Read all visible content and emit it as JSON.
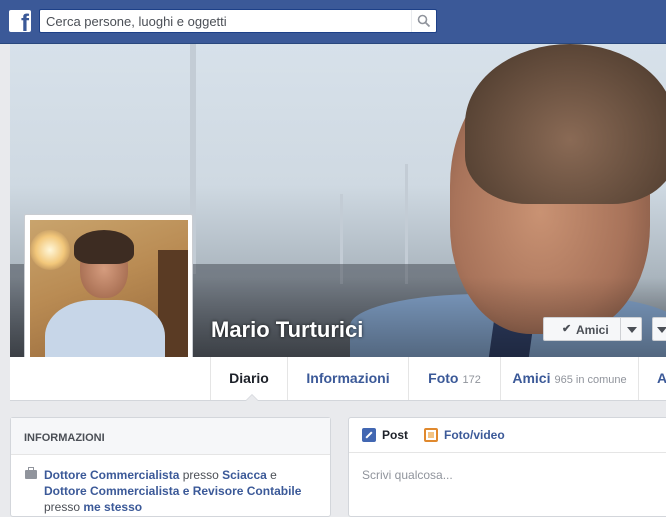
{
  "header": {
    "logo": "f",
    "search_placeholder": "Cerca persone, luoghi e oggetti",
    "brand_color": "#3b5998"
  },
  "profile": {
    "name": "Mario Turturici",
    "friends_button": "Amici"
  },
  "tabs": [
    {
      "label": "Diario",
      "count": ""
    },
    {
      "label": "Informazioni",
      "count": ""
    },
    {
      "label": "Foto",
      "count": "172"
    },
    {
      "label": "Amici",
      "count": "965 in comune"
    },
    {
      "label": "A",
      "count": ""
    }
  ],
  "info": {
    "title": "INFORMAZIONI",
    "line_link1": "Dottore Commercialista",
    "presso1": "presso",
    "link2": "Sciacca",
    "e": "e",
    "line_link3": "Dottore Commercialista e Revisore Contabile",
    "presso2": "presso",
    "link4": "me stesso"
  },
  "composer": {
    "tab_post": "Post",
    "tab_photo": "Foto/video",
    "placeholder": "Scrivi qualcosa..."
  }
}
